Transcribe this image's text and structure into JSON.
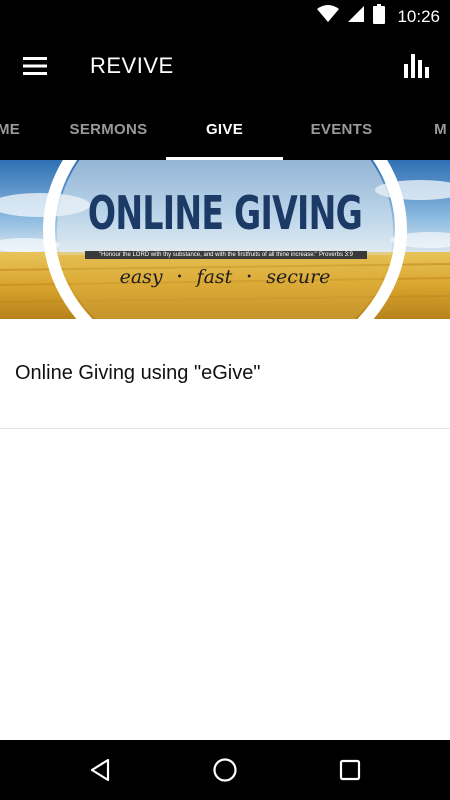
{
  "status_bar": {
    "time": "10:26",
    "icons": [
      "wifi-icon",
      "signal-icon",
      "battery-icon"
    ]
  },
  "app_bar": {
    "title": "REVIVE",
    "menu_icon": "hamburger-menu-icon",
    "stats_icon": "bar-chart-icon"
  },
  "tabs": [
    {
      "label": "ME",
      "active": false
    },
    {
      "label": "SERMONS",
      "active": false
    },
    {
      "label": "GIVE",
      "active": true
    },
    {
      "label": "EVENTS",
      "active": false
    },
    {
      "label": "M",
      "active": false
    }
  ],
  "banner": {
    "headline": "ONLINE GIVING",
    "verse": "\"Honour the LORD with thy substance, and with the firstfruits of all thine increase:\" Proverbs 3:9",
    "taglines": [
      "easy",
      "fast",
      "secure"
    ]
  },
  "list": {
    "items": [
      {
        "label": "Online Giving using \"eGive\""
      }
    ]
  },
  "nav_bar": {
    "icons": [
      "back-icon",
      "home-icon",
      "recents-icon"
    ]
  },
  "colors": {
    "app_bar": "#000000",
    "tab_inactive": "#9a9a9a",
    "tab_active": "#ffffff",
    "headline": "#1c3a66",
    "divider": "#e4e4e4"
  }
}
